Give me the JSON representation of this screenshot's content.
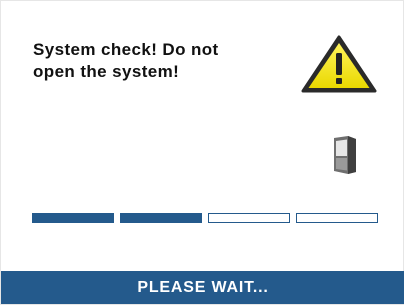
{
  "message": {
    "line1": "System check! Do not",
    "line2": "open the system!"
  },
  "icons": {
    "warning": "warning-triangle-icon",
    "device": "device-door-icon"
  },
  "progress": {
    "total_segments": 4,
    "filled_segments": 2,
    "fraction": 0.5
  },
  "footer": {
    "label": "PLEASE WAIT..."
  },
  "colors": {
    "accent": "#245a8c",
    "warning_fill": "#f3e600",
    "text": "#111111",
    "background": "#ffffff"
  }
}
